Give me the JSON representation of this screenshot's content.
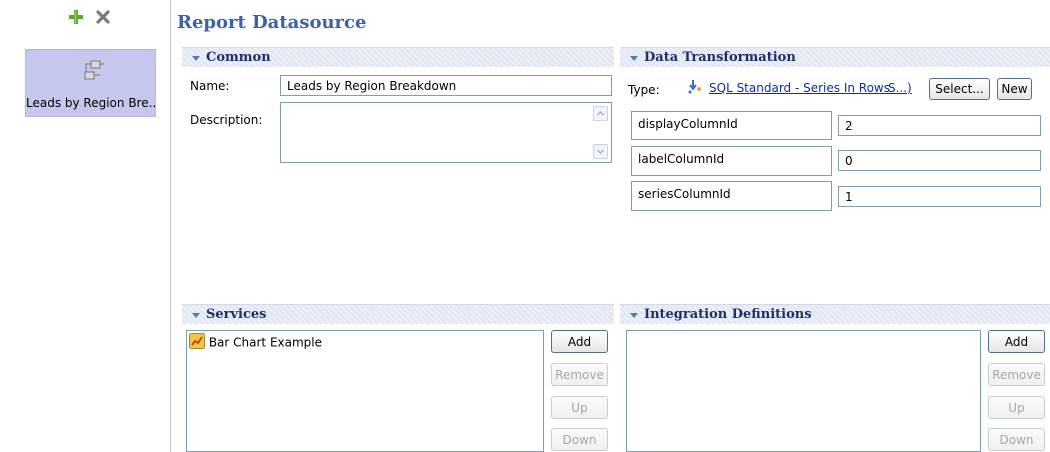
{
  "toolbar": {
    "add_icon": "plus-icon",
    "delete_icon": "x-icon"
  },
  "datasource_list": {
    "items": [
      {
        "label": "Leads by Region Bre...",
        "icon": "datasource-icon"
      }
    ]
  },
  "page_title": "Report Datasource",
  "common": {
    "header": "Common",
    "name_label": "Name:",
    "name_value": "Leads by Region Breakdown",
    "description_label": "Description:",
    "description_value": ""
  },
  "data_transformation": {
    "header": "Data Transformation",
    "type_label": "Type:",
    "type_icon": "transform-icon",
    "type_link": "SQL Standard - Series In Rows",
    "type_link_more": "S...)",
    "select_button": "Select...",
    "new_button": "New",
    "params": [
      {
        "name": "displayColumnId",
        "value": "2"
      },
      {
        "name": "labelColumnId",
        "value": "0"
      },
      {
        "name": "seriesColumnId",
        "value": "1"
      }
    ]
  },
  "services": {
    "header": "Services",
    "items": [
      {
        "label": "Bar Chart Example",
        "icon": "chart-service-icon"
      }
    ],
    "add_button": "Add",
    "remove_button": "Remove",
    "up_button": "Up",
    "down_button": "Down"
  },
  "integration_definitions": {
    "header": "Integration Definitions",
    "items": [],
    "add_button": "Add",
    "remove_button": "Remove",
    "up_button": "Up",
    "down_button": "Down"
  }
}
